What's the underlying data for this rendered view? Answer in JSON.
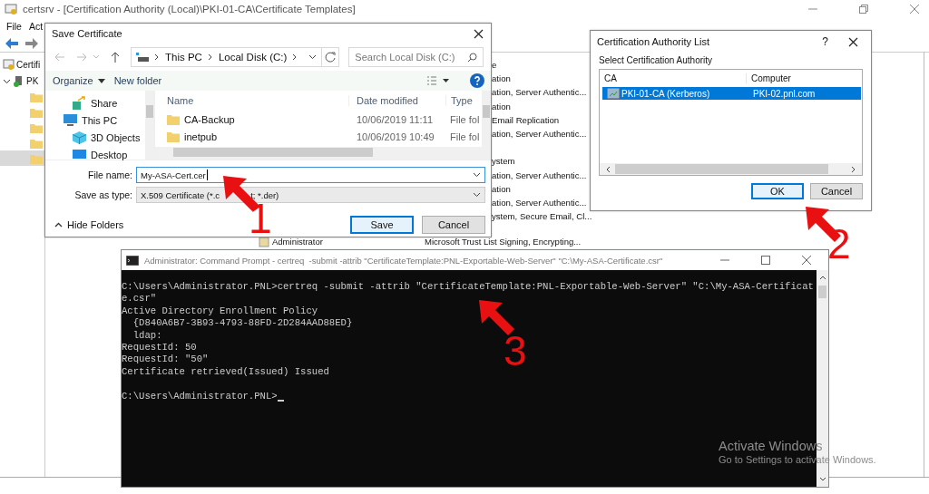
{
  "background_window": {
    "title": "certsrv - [Certification Authority (Local)\\PKI-01-CA\\Certificate Templates]",
    "menu": [
      "File",
      "Act"
    ],
    "tree": {
      "root": "Certifi",
      "children": [
        {
          "label": "PK",
          "expanded": true
        }
      ]
    },
    "list_header": "e",
    "list_rows_top": [
      "ation",
      "ation, Server Authentic...",
      "ation",
      "Email Replication",
      "ation, Server Authentic..."
    ],
    "list_rows_bottom": [
      "ystem",
      "ation, Server Authentic...",
      "ation",
      "ation, Server Authentic...",
      "ystem, Secure Email, Cl..."
    ],
    "bottom_row": {
      "name": "Administrator",
      "purpose": "Microsoft Trust List Signing, Encrypting..."
    }
  },
  "save_dialog": {
    "title": "Save Certificate",
    "breadcrumb": [
      "This PC",
      "Local Disk (C:)"
    ],
    "search": {
      "placeholder": "Search Local Disk (C:)"
    },
    "organize": "Organize",
    "new_folder": "New folder",
    "nav": [
      {
        "label": "Share"
      },
      {
        "label": "This PC",
        "children": [
          {
            "label": "3D Objects"
          },
          {
            "label": "Desktop"
          }
        ]
      }
    ],
    "columns": [
      "Name",
      "Date modified",
      "Type"
    ],
    "files": [
      {
        "name": "CA-Backup",
        "date": "10/06/2019 11:11",
        "type": "File fol"
      },
      {
        "name": "inetpub",
        "date": "10/06/2019 10:49",
        "type": "File fol"
      }
    ],
    "file_name": {
      "label": "File name:",
      "value": "My-ASA-Cert.cer"
    },
    "save_as_type": {
      "label": "Save as type:",
      "value_parts": [
        "X.509 Certificate (*.c",
        "t; *.der)"
      ]
    },
    "hide_folders": "Hide Folders",
    "buttons": [
      {
        "label": "Save",
        "default": true
      },
      {
        "label": "Cancel",
        "default": false
      }
    ]
  },
  "ca_dialog": {
    "title": "Certification Authority List",
    "help": "?",
    "prompt": "Select Certification Authority",
    "columns": [
      "CA",
      "Computer"
    ],
    "rows": [
      {
        "ca": "PKI-01-CA (Kerberos)",
        "computer": "PKI-02.pnl.com",
        "selected": true
      }
    ],
    "buttons": [
      {
        "label": "OK",
        "default": true
      },
      {
        "label": "Cancel",
        "default": false
      }
    ]
  },
  "command_prompt": {
    "title": "Administrator: Command Prompt - certreq  -submit -attrib \"CertificateTemplate:PNL-Exportable-Web-Server\" \"C:\\My-ASA-Certificate.csr\"",
    "output": [
      "C:\\Users\\Administrator.PNL>certreq -submit -attrib \"CertificateTemplate:PNL-Exportable-Web-Server\" \"C:\\My-ASA-Certificat",
      "e.csr\"",
      "Active Directory Enrollment Policy",
      "  {D840A6B7-3B93-4793-88FD-2D284AAD88ED}",
      "  ldap:",
      "RequestId: 50",
      "RequestId: \"50\"",
      "Certificate retrieved(Issued) Issued"
    ],
    "prompt": "C:\\Users\\Administrator.PNL>",
    "cursor": true
  },
  "annotations": [
    {
      "number": "1"
    },
    {
      "number": "2"
    },
    {
      "number": "3"
    }
  ],
  "activation_notice": {
    "heading": "Activate Windows",
    "text": "Go to Settings to activate Windows."
  }
}
